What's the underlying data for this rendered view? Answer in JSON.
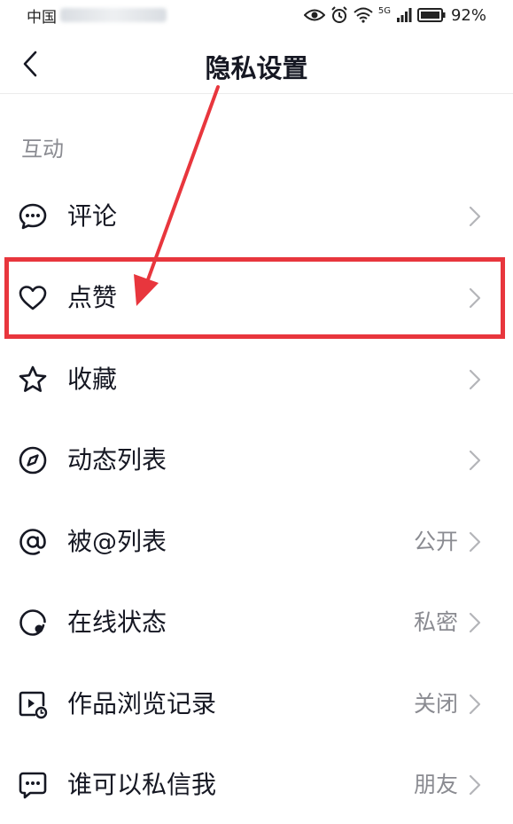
{
  "status_bar": {
    "carrier": "中国",
    "battery": "92%",
    "network": "5G"
  },
  "nav": {
    "title": "隐私设置"
  },
  "section": {
    "header": "互动"
  },
  "rows": [
    {
      "label": "评论",
      "value": "",
      "icon": "comment-icon"
    },
    {
      "label": "点赞",
      "value": "",
      "icon": "heart-icon"
    },
    {
      "label": "收藏",
      "value": "",
      "icon": "star-icon"
    },
    {
      "label": "动态列表",
      "value": "",
      "icon": "compass-icon"
    },
    {
      "label": "被@列表",
      "value": "公开",
      "icon": "at-icon"
    },
    {
      "label": "在线状态",
      "value": "私密",
      "icon": "online-status-icon"
    },
    {
      "label": "作品浏览记录",
      "value": "关闭",
      "icon": "video-history-icon"
    },
    {
      "label": "谁可以私信我",
      "value": "朋友",
      "icon": "message-icon"
    }
  ],
  "colors": {
    "highlight": "#e8363d",
    "text": "#161823",
    "secondary": "#8a8b91"
  }
}
